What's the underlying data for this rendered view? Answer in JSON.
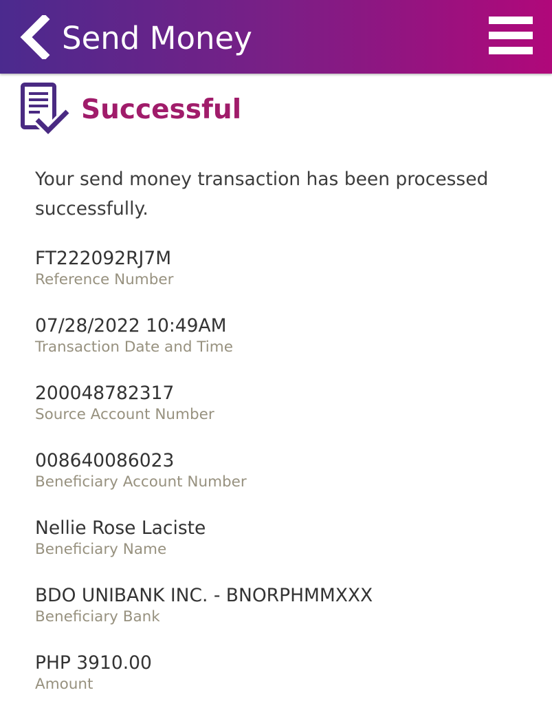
{
  "header": {
    "title": "Send Money",
    "back_icon": "chevron-left-icon",
    "menu_icon": "hamburger-menu-icon"
  },
  "status": {
    "title": "Successful",
    "icon": "document-check-icon",
    "message": "Your send money transaction has been processed successfully."
  },
  "fields": [
    {
      "value": "FT222092RJ7M",
      "label": "Reference Number"
    },
    {
      "value": "07/28/2022 10:49AM",
      "label": "Transaction Date and Time"
    },
    {
      "value": "200048782317",
      "label": "Source Account Number"
    },
    {
      "value": "008640086023",
      "label": "Beneficiary Account Number"
    },
    {
      "value": "Nellie Rose Laciste",
      "label": "Beneficiary Name"
    },
    {
      "value": "BDO UNIBANK INC. - BNORPHMMXXX",
      "label": "Beneficiary Bank"
    },
    {
      "value": "PHP 3910.00",
      "label": "Amount"
    }
  ],
  "colors": {
    "header_gradient_start": "#4b2a8e",
    "header_gradient_end": "#b0087a",
    "success_title": "#a01c6a",
    "icon_purple": "#4a2a82",
    "label_gray": "#97917f"
  }
}
